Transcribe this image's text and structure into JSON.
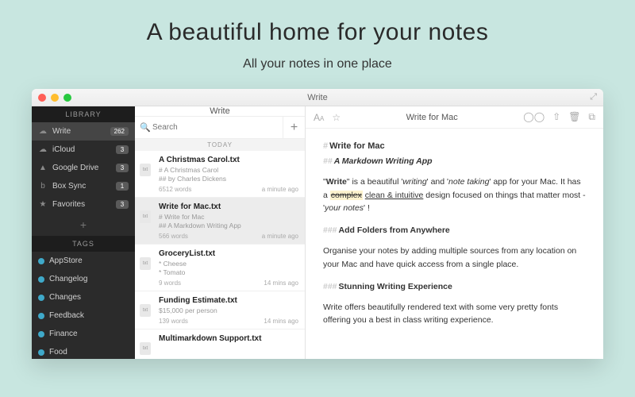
{
  "hero": {
    "title": "A beautiful home for your notes",
    "subtitle": "All your notes in one place"
  },
  "window": {
    "title": "Write"
  },
  "sidebar": {
    "library_header": "LIBRARY",
    "tags_header": "TAGS",
    "items": [
      {
        "icon": "☁",
        "label": "Write",
        "badge": "262",
        "active": true
      },
      {
        "icon": "☁",
        "label": "iCloud",
        "badge": "3"
      },
      {
        "icon": "▲",
        "label": "Google Drive",
        "badge": "3"
      },
      {
        "icon": "b",
        "label": "Box Sync",
        "badge": "1"
      },
      {
        "icon": "★",
        "label": "Favorites",
        "badge": "3"
      }
    ],
    "add": "+",
    "tags": [
      "AppStore",
      "Changelog",
      "Changes",
      "Feedback",
      "Finance",
      "Food"
    ]
  },
  "notelist": {
    "title": "Write",
    "search_placeholder": "Search",
    "today": "TODAY",
    "notes": [
      {
        "title": "A Christmas Carol.txt",
        "preview1": "# A Christmas Carol",
        "preview2": "## by Charles Dickens",
        "words": "6512 words",
        "time": "a minute ago"
      },
      {
        "title": "Write for Mac.txt",
        "preview1": "# Write for Mac",
        "preview2": "## A Markdown Writing App",
        "words": "566 words",
        "time": "a minute ago",
        "selected": true
      },
      {
        "title": "GroceryList.txt",
        "preview1": "* Cheese",
        "preview2": "* Tomato",
        "words": "9 words",
        "time": "14 mins ago"
      },
      {
        "title": "Funding Estimate.txt",
        "preview1": "$15,000 per person",
        "preview2": "",
        "words": "139 words",
        "time": "14 mins ago"
      },
      {
        "title": "Multimarkdown Support.txt",
        "preview1": "",
        "preview2": "",
        "words": "",
        "time": ""
      }
    ]
  },
  "editor": {
    "toolbar_title": "Write for Mac",
    "h1": "Write for Mac",
    "h2": "A Markdown Writing App",
    "p1a": "\"",
    "p1b": "Write",
    "p1c": "\" is a beautiful '",
    "p1d": "writing",
    "p1e": "' and '",
    "p1f": "note taking",
    "p1g": "' app for your Mac. It has a ",
    "p1_strike": "complex",
    "p1_ul": "clean & intuitive",
    "p1h": " design focused on things that matter most - '",
    "p1i": "your notes",
    "p1j": "' !",
    "h3a": "Add Folders from Anywhere",
    "p2": "Organise your notes by adding multiple sources from any location on your Mac and have quick access from a single place.",
    "h3b": "Stunning Writing Experience",
    "p3": "Write offers beautifully rendered text with some very pretty fonts offering you a best in class writing experience."
  }
}
